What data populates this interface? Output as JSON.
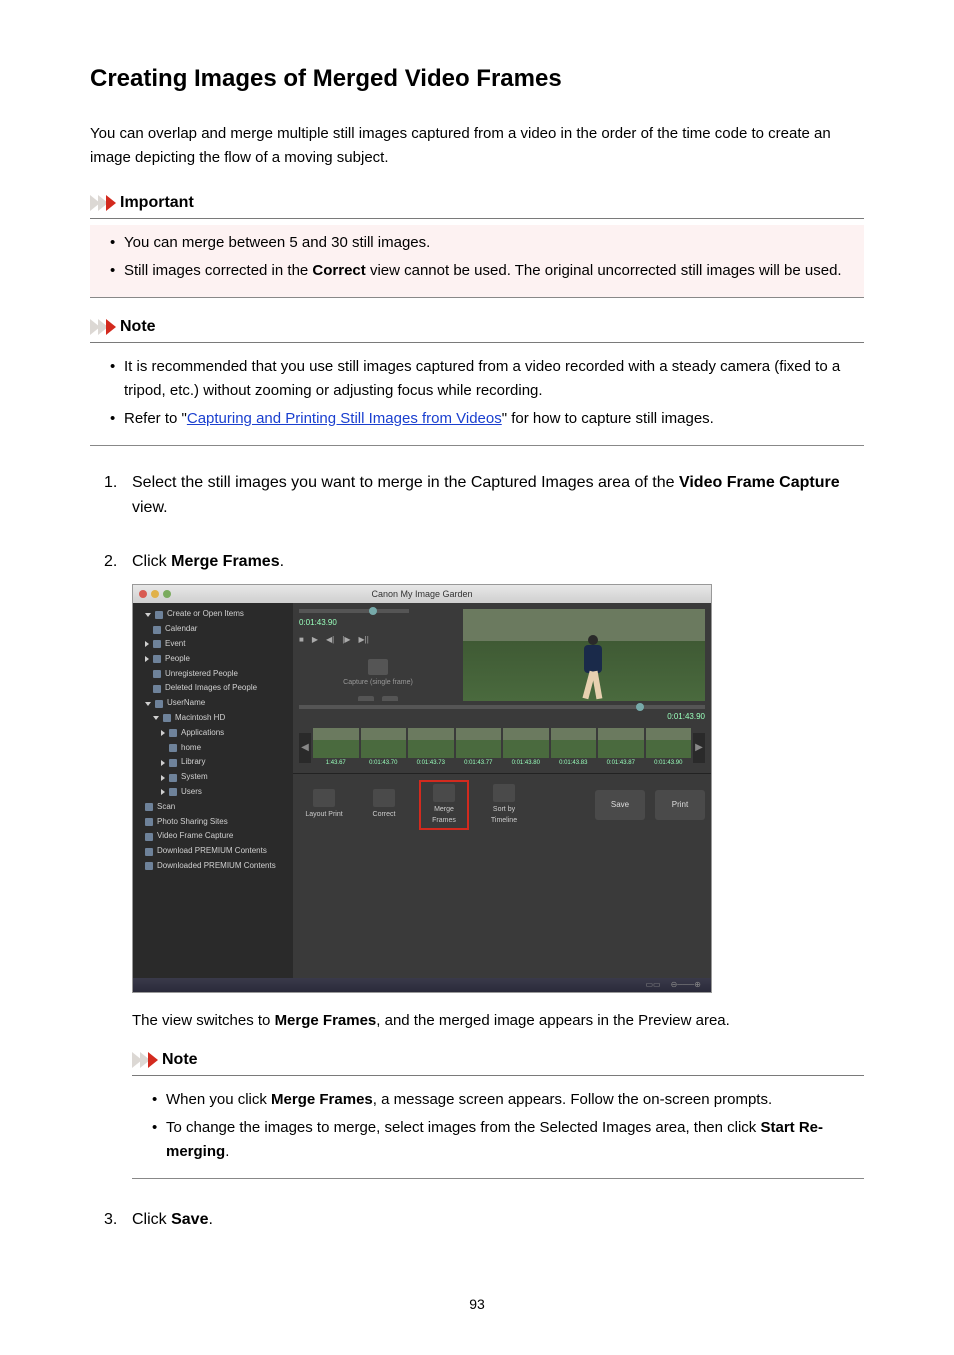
{
  "title": "Creating Images of Merged Video Frames",
  "intro": "You can overlap and merge multiple still images captured from a video in the order of the time code to create an image depicting the flow of a moving subject.",
  "important": {
    "heading": "Important",
    "items": [
      {
        "pre": "You can merge between 5 and 30 still images."
      },
      {
        "pre": "Still images corrected in the ",
        "bold": "Correct",
        "post": " view cannot be used. The original uncorrected still images will be used."
      }
    ]
  },
  "note1": {
    "heading": "Note",
    "items": [
      {
        "text": "It is recommended that you use still images captured from a video recorded with a steady camera (fixed to a tripod, etc.) without zooming or adjusting focus while recording."
      },
      {
        "pre": "Refer to \"",
        "link": "Capturing and Printing Still Images from Videos",
        "post": "\" for how to capture still images."
      }
    ]
  },
  "steps": {
    "s1": {
      "pre": "Select the still images you want to merge in the Captured Images area of the ",
      "bold": "Video Frame Capture",
      "post": " view."
    },
    "s2": {
      "pre": "Click ",
      "bold": "Merge Frames",
      "post": "."
    },
    "s2_after": {
      "pre": "The view switches to ",
      "bold": "Merge Frames",
      "post": ", and the merged image appears in the Preview area."
    },
    "s3": {
      "pre": "Click ",
      "bold": "Save",
      "post": "."
    }
  },
  "note2": {
    "heading": "Note",
    "items": [
      {
        "pre": "When you click ",
        "bold": "Merge Frames",
        "post": ", a message screen appears. Follow the on-screen prompts."
      },
      {
        "pre": "To change the images to merge, select images from the Selected Images area, then click ",
        "bold": "Start Re-merging",
        "post": "."
      }
    ]
  },
  "screenshot": {
    "app_title": "Canon My Image Garden",
    "sidebar": {
      "create": "Create or Open Items",
      "calendar": "Calendar",
      "event": "Event",
      "people": "People",
      "unregistered": "Unregistered People",
      "deleted": "Deleted Images of People",
      "username": "UserName",
      "mac": "Macintosh HD",
      "applications": "Applications",
      "home": "home",
      "library": "Library",
      "system": "System",
      "users": "Users",
      "scan": "Scan",
      "photo_sharing": "Photo Sharing Sites",
      "video_frame": "Video Frame Capture",
      "download_premium": "Download PREMIUM Contents",
      "downloaded_premium": "Downloaded PREMIUM Contents"
    },
    "controls": {
      "time": "0:01:43.90",
      "capture_label": "Capture (single frame)"
    },
    "timeline_time": "0:01:43.90",
    "thumbs": [
      "1:43.67",
      "0:01:43.70",
      "0:01:43.73",
      "0:01:43.77",
      "0:01:43.80",
      "0:01:43.83",
      "0:01:43.87",
      "0:01:43.90"
    ],
    "tools": {
      "layout": "Layout Print",
      "correct": "Correct",
      "merge": "Merge Frames",
      "sort": "Sort by Timeline",
      "save": "Save",
      "print": "Print"
    }
  },
  "page_number": "93"
}
